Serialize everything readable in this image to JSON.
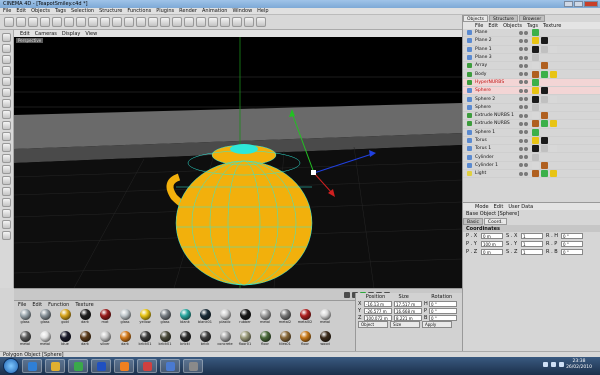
{
  "title": "CINEMA 4D - [TeapotSmiley.c4d *]",
  "menu": [
    "File",
    "Edit",
    "Objects",
    "Tags",
    "Selection",
    "Structure",
    "Functions",
    "Plugins",
    "Render",
    "Animation",
    "Window",
    "Help"
  ],
  "viewport": {
    "menu": [
      "Edit",
      "Cameras",
      "Display",
      "View"
    ],
    "label": "Perspective"
  },
  "object_manager": {
    "tabs": [
      "Objects",
      "Structure",
      "Browser"
    ],
    "menu": [
      "File",
      "Edit",
      "Objects",
      "Tags",
      "Texture"
    ],
    "items": [
      {
        "name": "Plane",
        "color": "#5a8ad0"
      },
      {
        "name": "Plane 2",
        "color": "#5a8ad0"
      },
      {
        "name": "Plane 1",
        "color": "#5a8ad0"
      },
      {
        "name": "Plane 3",
        "color": "#5a8ad0"
      },
      {
        "name": "Array",
        "color": "#3c9c3c"
      },
      {
        "name": "Body",
        "color": "#3c9c3c"
      },
      {
        "name": "HyperNURBS",
        "color": "#3c9c3c",
        "selected": true
      },
      {
        "name": "Sphere",
        "color": "#5a8ad0",
        "selected": true
      },
      {
        "name": "Sphere 2",
        "color": "#5a8ad0"
      },
      {
        "name": "Sphere",
        "color": "#5a8ad0"
      },
      {
        "name": "Extrude NURBS 1",
        "color": "#3c9c3c"
      },
      {
        "name": "Extrude NURBS",
        "color": "#3c9c3c"
      },
      {
        "name": "Sphere 1",
        "color": "#5a8ad0"
      },
      {
        "name": "Torus",
        "color": "#5a8ad0"
      },
      {
        "name": "Torus 1",
        "color": "#5a8ad0"
      },
      {
        "name": "Cylinder",
        "color": "#5a8ad0"
      },
      {
        "name": "Cylinder 1",
        "color": "#5a8ad0"
      },
      {
        "name": "Light",
        "color": "#e0d040"
      }
    ]
  },
  "attributes": {
    "menu": [
      "Mode",
      "Edit",
      "User Data"
    ],
    "object_label": "Base Object [Sphere]",
    "tabs": [
      "Basic",
      "Coord."
    ],
    "section": "Coordinates",
    "rows": [
      {
        "p": "P . X",
        "pv": "0 m",
        "s": "S . X",
        "sv": "1",
        "r": "R . H",
        "rv": "0 °"
      },
      {
        "p": "P . Y",
        "pv": "100 m",
        "s": "S . Y",
        "sv": "1",
        "r": "R . P",
        "rv": "0 °"
      },
      {
        "p": "P . Z",
        "pv": "0 m",
        "s": "S . Z",
        "sv": "1",
        "r": "R . B",
        "rv": "0 °"
      }
    ]
  },
  "coordinates": {
    "headers": [
      "Position",
      "Size",
      "Rotation"
    ],
    "rows": [
      {
        "axis": "X",
        "pos": "-16.13 m",
        "size": "17.517 m",
        "rot_label": "H",
        "rot": "0 °"
      },
      {
        "axis": "Y",
        "pos": "-26.577 m",
        "size": "16.668 m",
        "rot_label": "P",
        "rot": "0 °"
      },
      {
        "axis": "Z",
        "pos": "100.072 m",
        "size": "8.221 m",
        "rot_label": "B",
        "rot": "0 °"
      }
    ],
    "mode_left": "Object",
    "mode_mid": "Size",
    "apply": "Apply"
  },
  "materials": {
    "menu": [
      "File",
      "Edit",
      "Function",
      "Texture"
    ],
    "items": [
      {
        "name": "glass",
        "color": "#9aa6ad"
      },
      {
        "name": "glass",
        "color": "#8a949b"
      },
      {
        "name": "gold",
        "color": "#d8a51c"
      },
      {
        "name": "dark",
        "color": "#222222"
      },
      {
        "name": "mat",
        "color": "#9a1c1c"
      },
      {
        "name": "glass",
        "color": "#c0c8cc"
      },
      {
        "name": "yellow",
        "color": "#e8c414"
      },
      {
        "name": "glass",
        "color": "#7a8086"
      },
      {
        "name": "blank",
        "color": "#2aa8a0"
      },
      {
        "name": "blank01",
        "color": "#1c2e3a"
      },
      {
        "name": "plastic",
        "color": "#d0d0d0"
      },
      {
        "name": "rubber",
        "color": "#1a1a1a"
      },
      {
        "name": "metal",
        "color": "#a0a0a0"
      },
      {
        "name": "metal2",
        "color": "#7a7a7a"
      },
      {
        "name": "metal02",
        "color": "#b02020"
      },
      {
        "name": "metal",
        "color": "#d8d8d8"
      },
      {
        "name": "metal",
        "color": "#5a5a5a"
      },
      {
        "name": "metal",
        "color": "#e0e0e0"
      },
      {
        "name": "blue",
        "color": "#1a1a2a"
      },
      {
        "name": "dark",
        "color": "#5a3a1a"
      },
      {
        "name": "silver",
        "color": "#c8c8c8"
      },
      {
        "name": "dark",
        "color": "#d47a1a"
      },
      {
        "name": "brick01",
        "color": "#3a3a3a"
      },
      {
        "name": "brick01",
        "color": "#4a4a3a"
      },
      {
        "name": "bricki",
        "color": "#2a2a2a"
      },
      {
        "name": "brick",
        "color": "#3e3e3e"
      },
      {
        "name": "concrete",
        "color": "#a8a8a8"
      },
      {
        "name": "floor01",
        "color": "#9a9a7a"
      },
      {
        "name": "floor",
        "color": "#4a6a3a"
      },
      {
        "name": "tiles01",
        "color": "#8a6a3a"
      },
      {
        "name": "floor",
        "color": "#c87a1a"
      },
      {
        "name": "wood",
        "color": "#3a2a1a"
      },
      {
        "name": "wood01",
        "color": "#b8a040"
      },
      {
        "name": "steel01",
        "color": "#7a8a9a"
      },
      {
        "name": "steel",
        "color": "#2a3a4a"
      }
    ]
  },
  "status": "Polygon Object [Sphere]",
  "taskbar": {
    "apps": [
      {
        "name": "ie",
        "color": "#2f7fd6"
      },
      {
        "name": "explorer",
        "color": "#e0b030"
      },
      {
        "name": "chrome",
        "color": "#3aa84a"
      },
      {
        "name": "media",
        "color": "#2050c0"
      },
      {
        "name": "vlc",
        "color": "#f08020"
      },
      {
        "name": "paint",
        "color": "#d04040"
      },
      {
        "name": "cinema4d",
        "color": "#4a7ad0"
      },
      {
        "name": "app",
        "color": "#8a8a8a"
      }
    ],
    "time": "23:38",
    "date": "26/02/2010"
  },
  "colors": {
    "teapot": "#f2b00c",
    "wire": "#2ee8d8",
    "floor": "#0a0a0a"
  }
}
